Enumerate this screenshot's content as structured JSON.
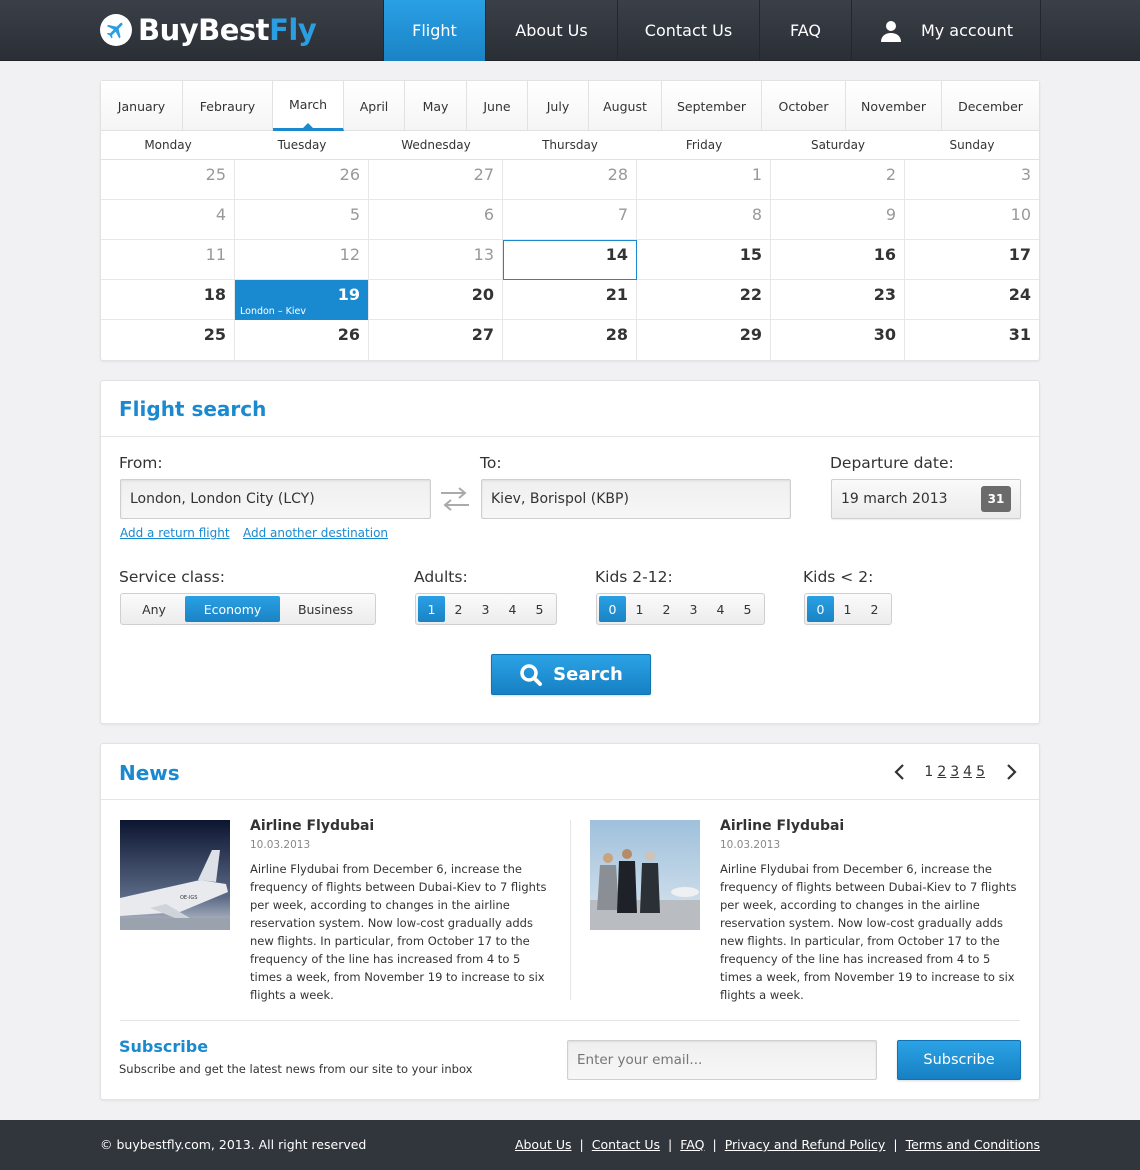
{
  "brand": {
    "name_part1": "BuyBest",
    "name_part2": "Fly",
    "accent": "#2a9ee0"
  },
  "nav": {
    "items": [
      {
        "label": "Flight",
        "active": true
      },
      {
        "label": "About Us"
      },
      {
        "label": "Contact Us"
      },
      {
        "label": "FAQ"
      },
      {
        "label": "My account",
        "icon": "user-icon"
      }
    ]
  },
  "calendar": {
    "months": [
      "January",
      "Febraury",
      "March",
      "April",
      "May",
      "June",
      "July",
      "August",
      "September",
      "October",
      "November",
      "December"
    ],
    "active_month": "March",
    "weekdays": [
      "Monday",
      "Tuesday",
      "Wednesday",
      "Thursday",
      "Friday",
      "Saturday",
      "Sunday"
    ],
    "weeks": [
      [
        "25",
        "26",
        "27",
        "28",
        "1",
        "2",
        "3"
      ],
      [
        "4",
        "5",
        "6",
        "7",
        "8",
        "9",
        "10"
      ],
      [
        "11",
        "12",
        "13",
        "14",
        "15",
        "16",
        "17"
      ],
      [
        "18",
        "19",
        "20",
        "21",
        "22",
        "23",
        "24"
      ],
      [
        "25",
        "26",
        "27",
        "28",
        "29",
        "30",
        "31"
      ]
    ],
    "today": "14",
    "selected": {
      "day": "19",
      "event": "London – Kiev"
    }
  },
  "flight_search": {
    "title": "Flight search",
    "from_label": "From:",
    "from_value": "London, London City (LCY)",
    "to_label": "To:",
    "to_value": "Kiev, Borispol (KBP)",
    "date_label": "Departure date:",
    "date_value": "19 march 2013",
    "calendar_icon_text": "31",
    "add_return": "Add a return flight",
    "add_destination": "Add another destination",
    "service_label": "Service class:",
    "service_options": [
      "Any",
      "Economy",
      "Business"
    ],
    "service_selected": "Economy",
    "adults_label": "Adults:",
    "adults_options": [
      "1",
      "2",
      "3",
      "4",
      "5"
    ],
    "adults_selected": "1",
    "kids_label": "Kids 2-12:",
    "kids_options": [
      "0",
      "1",
      "2",
      "3",
      "4",
      "5"
    ],
    "kids_selected": "0",
    "infants_label": "Kids < 2:",
    "infants_options": [
      "0",
      "1",
      "2"
    ],
    "infants_selected": "0",
    "search_label": "Search"
  },
  "news": {
    "title": "News",
    "pages": [
      "1",
      "2",
      "3",
      "4",
      "5"
    ],
    "current_page": "1",
    "items": [
      {
        "title": "Airline Flydubai",
        "date": "10.03.2013",
        "text": "Airline Flydubai from December 6, increase the frequency of flights between Dubai-Kiev to 7 flights per week, according to changes in the airline reservation system. Now low-cost gradually adds new flights. In particular, from October 17 to the frequency of the line has increased from 4 to 5 times a week, from November 19 to increase to six flights a week.",
        "image": "jet-photo",
        "image_text": "OE-IGS"
      },
      {
        "title": "Airline Flydubai",
        "date": "10.03.2013",
        "text": "Airline Flydubai from December 6, increase the frequency of flights between Dubai-Kiev to 7 flights per week, according to changes in the airline reservation system. Now low-cost gradually adds new flights. In particular, from October 17 to the frequency of the line has increased from 4 to 5 times a week, from November 19 to increase to six flights a week.",
        "image": "business-people-photo"
      }
    ]
  },
  "subscribe": {
    "title": "Subscribe",
    "text": "Subscribe and get the latest news from our site to your inbox",
    "placeholder": "Enter your email...",
    "button": "Subscribe"
  },
  "footer": {
    "copyright": "©  buybestfly.com, 2013. All right reserved",
    "links": [
      "About Us",
      "Contact Us",
      "FAQ",
      "Privacy and Refund Policy",
      "Terms and Conditions"
    ]
  }
}
